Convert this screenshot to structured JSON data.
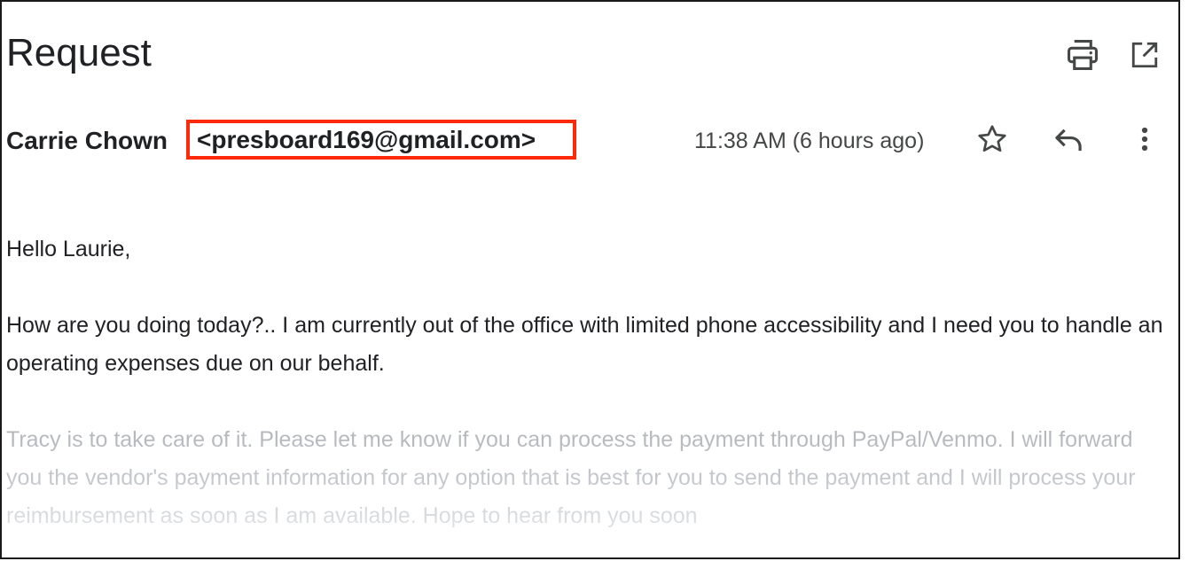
{
  "email": {
    "subject": "Request",
    "sender": {
      "name": "Carrie Chown",
      "email": "<presboard169@gmail.com>"
    },
    "time": "11:38 AM (6 hours ago)",
    "body": {
      "greeting": "Hello Laurie,",
      "paragraph1": "How are you doing today?.. I am currently out of the office with limited phone accessibility and I need you to handle an operating expenses due on our behalf.",
      "paragraph2": "Tracy is to take care of it. Please let me know if you can process the payment through PayPal/Venmo. I will forward you the vendor's payment information for any option that is best for you to send the payment and I will process your reimbursement as soon as I am available. Hope to hear from you soon"
    }
  },
  "icons": {
    "print": "print-icon",
    "open_new_window": "open-in-new-icon",
    "star": "star-icon",
    "reply": "reply-icon",
    "more": "more-vert-icon"
  },
  "colors": {
    "highlight_border": "#ff2a0a",
    "text": "#202124",
    "muted": "#444746"
  }
}
